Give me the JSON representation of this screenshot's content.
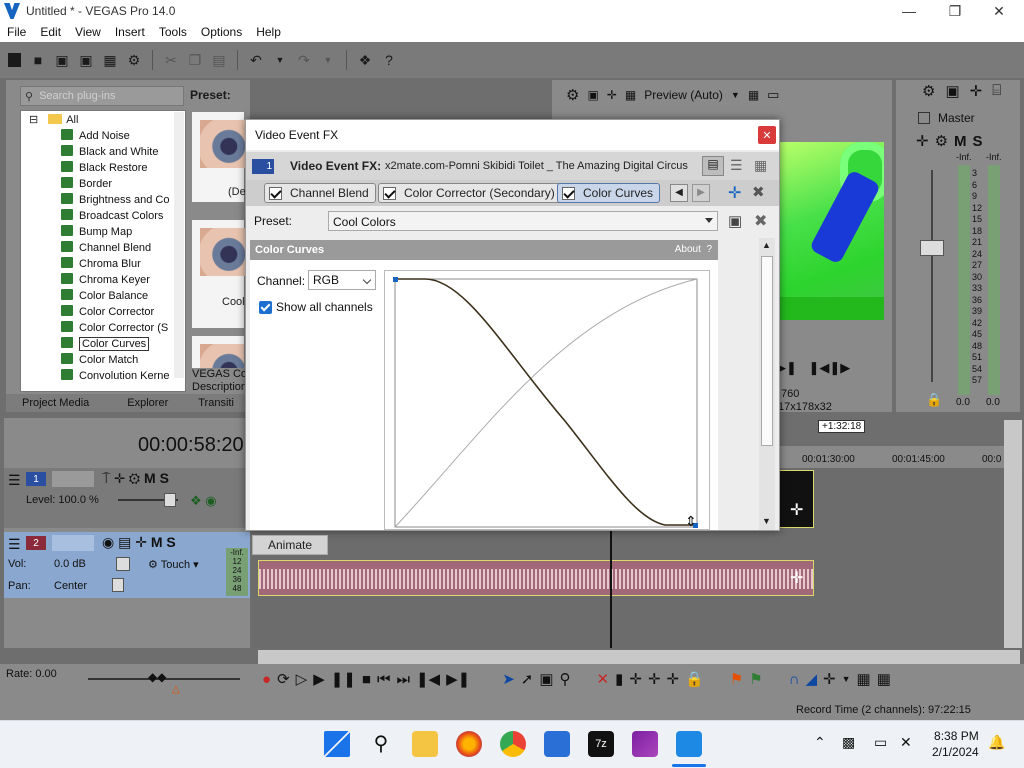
{
  "window": {
    "title": "Untitled * - VEGAS Pro 14.0"
  },
  "menu": [
    "File",
    "Edit",
    "View",
    "Insert",
    "Tools",
    "Options",
    "Help"
  ],
  "plugins": {
    "search_placeholder": "Search plug-ins",
    "root": "All",
    "items": [
      "Add Noise",
      "Black and White",
      "Black Restore",
      "Border",
      "Brightness and Co",
      "Broadcast Colors",
      "Bump Map",
      "Channel Blend",
      "Chroma Blur",
      "Chroma Keyer",
      "Color Balance",
      "Color Corrector",
      "Color Corrector (S",
      "Color Curves",
      "Color Match",
      "Convolution Kerne"
    ],
    "selected_index": 13,
    "preset_heading": "Preset:",
    "thumb_labels": [
      "(De",
      "Cool"
    ],
    "thumb_caption": [
      "VEGAS Colo",
      "Description"
    ]
  },
  "tabs_left": [
    "Project Media",
    "Explorer",
    "Transiti"
  ],
  "preview": {
    "mode": "Preview (Auto)",
    "info": [
      ",760",
      "17x178x32"
    ]
  },
  "master": {
    "label": "Master",
    "m": "M",
    "s": "S",
    "inf": [
      "-Inf.",
      "-Inf."
    ],
    "scale": [
      "3",
      "6",
      "9",
      "12",
      "15",
      "18",
      "21",
      "24",
      "27",
      "30",
      "33",
      "36",
      "39",
      "42",
      "45",
      "48",
      "51",
      "54",
      "57"
    ],
    "readout": [
      "0.0",
      "0.0"
    ]
  },
  "timeline": {
    "timecode": "00:00:58:20",
    "track1": {
      "num": "1",
      "level": "Level: 100.0 %"
    },
    "track2": {
      "num": "2",
      "vol": "Vol:",
      "vol_val": "0.0 dB",
      "pan": "Pan:",
      "pan_val": "Center",
      "touch": "Touch",
      "meter": [
        "-Inf.",
        "12",
        "24",
        "36",
        "48"
      ]
    },
    "ruler": [
      "00:01:30:00",
      "00:01:45:00",
      "00:0"
    ],
    "marker": "+1:32:18",
    "rate": "Rate: 0.00",
    "record_time": "Record Time (2 channels): 97:22:15"
  },
  "dialog": {
    "title": "Video Event FX",
    "fx_label": "Video Event FX:",
    "fx_name": "x2mate.com-Pomni Skibidi Toilet _ The Amazing Digital Circus",
    "track_num": "1",
    "chain": [
      "Channel Blend",
      "Color Corrector (Secondary)",
      "Color Curves"
    ],
    "preset_label": "Preset:",
    "preset_value": "Cool Colors",
    "panel_title": "Color Curves",
    "about": "About",
    "about_q": "?",
    "channel_label": "Channel:",
    "channel_value": "RGB",
    "show_all": "Show all channels",
    "animate": "Animate"
  },
  "clock": {
    "time": "8:38 PM",
    "date": "2/1/2024"
  },
  "colors": {
    "accent": "#1f6fd1",
    "close": "#d93a3a",
    "audio_clip": "#a06878"
  }
}
